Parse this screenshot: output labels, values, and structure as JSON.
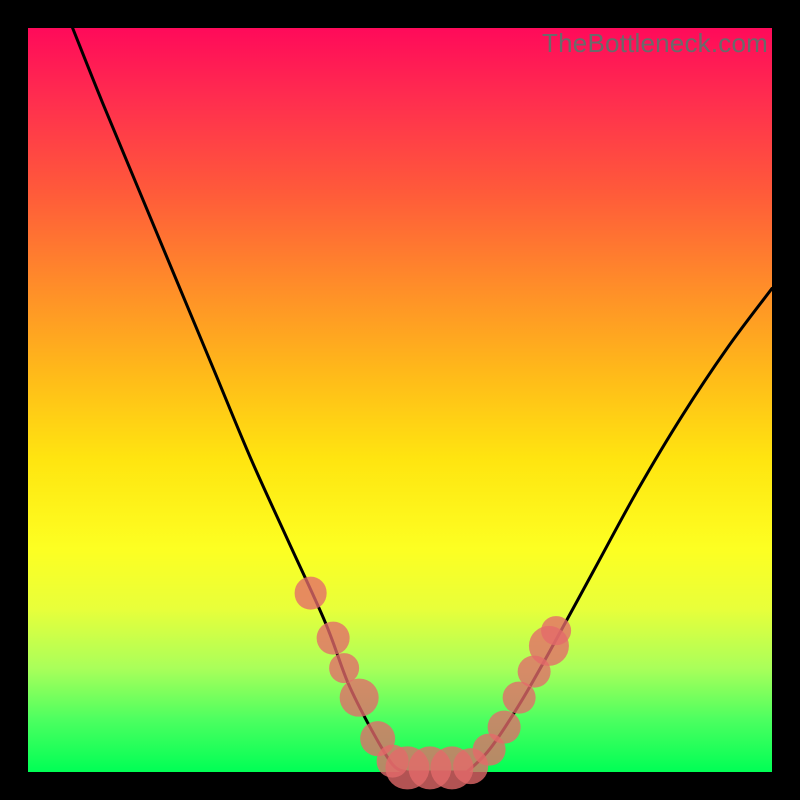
{
  "watermark": {
    "text": "TheBottleneck.com"
  },
  "colors": {
    "background": "#000000",
    "curve": "#000000",
    "marker": "#e46a6a",
    "gradient_top": "#ff0a5a",
    "gradient_bottom": "#00ff55"
  },
  "chart_data": {
    "type": "line",
    "title": "",
    "xlabel": "",
    "ylabel": "",
    "xlim": [
      0,
      100
    ],
    "ylim": [
      0,
      100
    ],
    "grid": false,
    "series": [
      {
        "name": "left-curve",
        "x": [
          6,
          10,
          15,
          20,
          25,
          30,
          35,
          40,
          43,
          46,
          49,
          51
        ],
        "y": [
          100,
          90,
          78,
          66,
          54,
          42,
          31,
          20,
          12,
          6,
          1,
          0
        ],
        "stroke": "#000000"
      },
      {
        "name": "bottom-flat",
        "x": [
          51,
          53,
          55,
          57,
          59
        ],
        "y": [
          0,
          0,
          0,
          0,
          0
        ],
        "stroke": "#000000"
      },
      {
        "name": "right-curve",
        "x": [
          59,
          62,
          66,
          70,
          76,
          82,
          88,
          94,
          100
        ],
        "y": [
          0,
          3,
          9,
          16,
          27,
          38,
          48,
          57,
          65
        ],
        "stroke": "#000000"
      }
    ],
    "markers": [
      {
        "x": 38,
        "y": 24,
        "r": 2.2
      },
      {
        "x": 41,
        "y": 18,
        "r": 2.2
      },
      {
        "x": 42.5,
        "y": 14,
        "r": 2.0
      },
      {
        "x": 44.5,
        "y": 10,
        "r": 2.6
      },
      {
        "x": 47,
        "y": 4.5,
        "r": 2.4
      },
      {
        "x": 49,
        "y": 1.5,
        "r": 2.2
      },
      {
        "x": 51,
        "y": 0.5,
        "r": 2.9
      },
      {
        "x": 54,
        "y": 0.5,
        "r": 2.9
      },
      {
        "x": 57,
        "y": 0.5,
        "r": 2.9
      },
      {
        "x": 59.5,
        "y": 0.8,
        "r": 2.4
      },
      {
        "x": 62,
        "y": 3,
        "r": 2.2
      },
      {
        "x": 64,
        "y": 6,
        "r": 2.2
      },
      {
        "x": 66,
        "y": 10,
        "r": 2.2
      },
      {
        "x": 68,
        "y": 13.5,
        "r": 2.2
      },
      {
        "x": 70,
        "y": 17,
        "r": 2.7
      },
      {
        "x": 71,
        "y": 19,
        "r": 2.0
      }
    ]
  }
}
